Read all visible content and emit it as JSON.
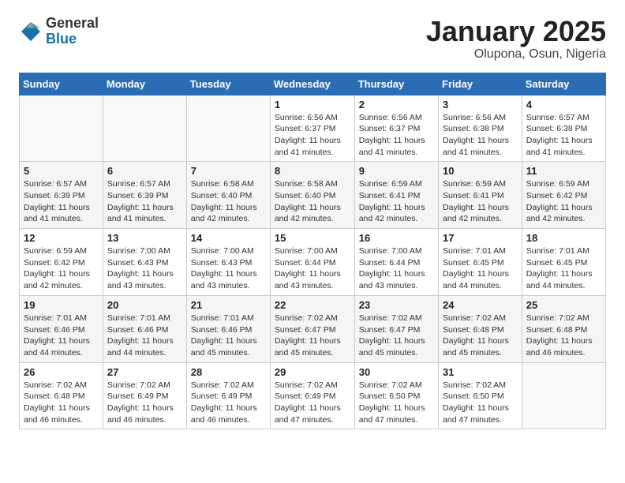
{
  "logo": {
    "general": "General",
    "blue": "Blue"
  },
  "title": "January 2025",
  "location": "Olupona, Osun, Nigeria",
  "weekdays": [
    "Sunday",
    "Monday",
    "Tuesday",
    "Wednesday",
    "Thursday",
    "Friday",
    "Saturday"
  ],
  "weeks": [
    [
      {
        "day": "",
        "info": ""
      },
      {
        "day": "",
        "info": ""
      },
      {
        "day": "",
        "info": ""
      },
      {
        "day": "1",
        "info": "Sunrise: 6:56 AM\nSunset: 6:37 PM\nDaylight: 11 hours\nand 41 minutes."
      },
      {
        "day": "2",
        "info": "Sunrise: 6:56 AM\nSunset: 6:37 PM\nDaylight: 11 hours\nand 41 minutes."
      },
      {
        "day": "3",
        "info": "Sunrise: 6:56 AM\nSunset: 6:38 PM\nDaylight: 11 hours\nand 41 minutes."
      },
      {
        "day": "4",
        "info": "Sunrise: 6:57 AM\nSunset: 6:38 PM\nDaylight: 11 hours\nand 41 minutes."
      }
    ],
    [
      {
        "day": "5",
        "info": "Sunrise: 6:57 AM\nSunset: 6:39 PM\nDaylight: 11 hours\nand 41 minutes."
      },
      {
        "day": "6",
        "info": "Sunrise: 6:57 AM\nSunset: 6:39 PM\nDaylight: 11 hours\nand 41 minutes."
      },
      {
        "day": "7",
        "info": "Sunrise: 6:58 AM\nSunset: 6:40 PM\nDaylight: 11 hours\nand 42 minutes."
      },
      {
        "day": "8",
        "info": "Sunrise: 6:58 AM\nSunset: 6:40 PM\nDaylight: 11 hours\nand 42 minutes."
      },
      {
        "day": "9",
        "info": "Sunrise: 6:59 AM\nSunset: 6:41 PM\nDaylight: 11 hours\nand 42 minutes."
      },
      {
        "day": "10",
        "info": "Sunrise: 6:59 AM\nSunset: 6:41 PM\nDaylight: 11 hours\nand 42 minutes."
      },
      {
        "day": "11",
        "info": "Sunrise: 6:59 AM\nSunset: 6:42 PM\nDaylight: 11 hours\nand 42 minutes."
      }
    ],
    [
      {
        "day": "12",
        "info": "Sunrise: 6:59 AM\nSunset: 6:42 PM\nDaylight: 11 hours\nand 42 minutes."
      },
      {
        "day": "13",
        "info": "Sunrise: 7:00 AM\nSunset: 6:43 PM\nDaylight: 11 hours\nand 43 minutes."
      },
      {
        "day": "14",
        "info": "Sunrise: 7:00 AM\nSunset: 6:43 PM\nDaylight: 11 hours\nand 43 minutes."
      },
      {
        "day": "15",
        "info": "Sunrise: 7:00 AM\nSunset: 6:44 PM\nDaylight: 11 hours\nand 43 minutes."
      },
      {
        "day": "16",
        "info": "Sunrise: 7:00 AM\nSunset: 6:44 PM\nDaylight: 11 hours\nand 43 minutes."
      },
      {
        "day": "17",
        "info": "Sunrise: 7:01 AM\nSunset: 6:45 PM\nDaylight: 11 hours\nand 44 minutes."
      },
      {
        "day": "18",
        "info": "Sunrise: 7:01 AM\nSunset: 6:45 PM\nDaylight: 11 hours\nand 44 minutes."
      }
    ],
    [
      {
        "day": "19",
        "info": "Sunrise: 7:01 AM\nSunset: 6:46 PM\nDaylight: 11 hours\nand 44 minutes."
      },
      {
        "day": "20",
        "info": "Sunrise: 7:01 AM\nSunset: 6:46 PM\nDaylight: 11 hours\nand 44 minutes."
      },
      {
        "day": "21",
        "info": "Sunrise: 7:01 AM\nSunset: 6:46 PM\nDaylight: 11 hours\nand 45 minutes."
      },
      {
        "day": "22",
        "info": "Sunrise: 7:02 AM\nSunset: 6:47 PM\nDaylight: 11 hours\nand 45 minutes."
      },
      {
        "day": "23",
        "info": "Sunrise: 7:02 AM\nSunset: 6:47 PM\nDaylight: 11 hours\nand 45 minutes."
      },
      {
        "day": "24",
        "info": "Sunrise: 7:02 AM\nSunset: 6:48 PM\nDaylight: 11 hours\nand 45 minutes."
      },
      {
        "day": "25",
        "info": "Sunrise: 7:02 AM\nSunset: 6:48 PM\nDaylight: 11 hours\nand 46 minutes."
      }
    ],
    [
      {
        "day": "26",
        "info": "Sunrise: 7:02 AM\nSunset: 6:48 PM\nDaylight: 11 hours\nand 46 minutes."
      },
      {
        "day": "27",
        "info": "Sunrise: 7:02 AM\nSunset: 6:49 PM\nDaylight: 11 hours\nand 46 minutes."
      },
      {
        "day": "28",
        "info": "Sunrise: 7:02 AM\nSunset: 6:49 PM\nDaylight: 11 hours\nand 46 minutes."
      },
      {
        "day": "29",
        "info": "Sunrise: 7:02 AM\nSunset: 6:49 PM\nDaylight: 11 hours\nand 47 minutes."
      },
      {
        "day": "30",
        "info": "Sunrise: 7:02 AM\nSunset: 6:50 PM\nDaylight: 11 hours\nand 47 minutes."
      },
      {
        "day": "31",
        "info": "Sunrise: 7:02 AM\nSunset: 6:50 PM\nDaylight: 11 hours\nand 47 minutes."
      },
      {
        "day": "",
        "info": ""
      }
    ]
  ]
}
